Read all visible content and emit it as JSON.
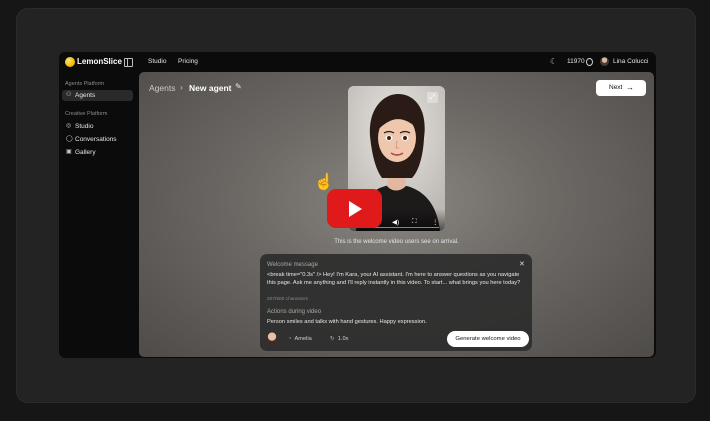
{
  "topbar": {
    "brand": "LemonSlice",
    "nav": [
      "Studio",
      "Pricing"
    ],
    "credits": "11970",
    "user_name": "Lina Colucci"
  },
  "sidebar": {
    "agents_section": "Agents Platform",
    "agents_item": "Agents",
    "creative_section": "Creative Platform",
    "creative_items": [
      "Studio",
      "Conversations",
      "Gallery"
    ]
  },
  "breadcrumb": {
    "root": "Agents",
    "separator": "›",
    "current": "New agent"
  },
  "next_button": "Next",
  "video": {
    "caption": "This is the welcome video users see on arrival."
  },
  "welcome": {
    "title": "Welcome message",
    "message": "<break time=\"0.3s\" /> Hey! I'm Kara, your AI assistant. I'm here to answer questions as you navigate this page. Ask me anything and I'll reply instantly in this video. To start... what brings you here today?",
    "char_count": "207/500 characters",
    "actions_title": "Actions during video",
    "actions_text": "Person smiles and talks with hand gestures. Happy expression.",
    "voice": "Amelia",
    "speed": "1.0x",
    "generate_button": "Generate welcome video"
  },
  "colors": {
    "play_button": "#e01a1a",
    "brand_lemon": "#f2b400"
  }
}
